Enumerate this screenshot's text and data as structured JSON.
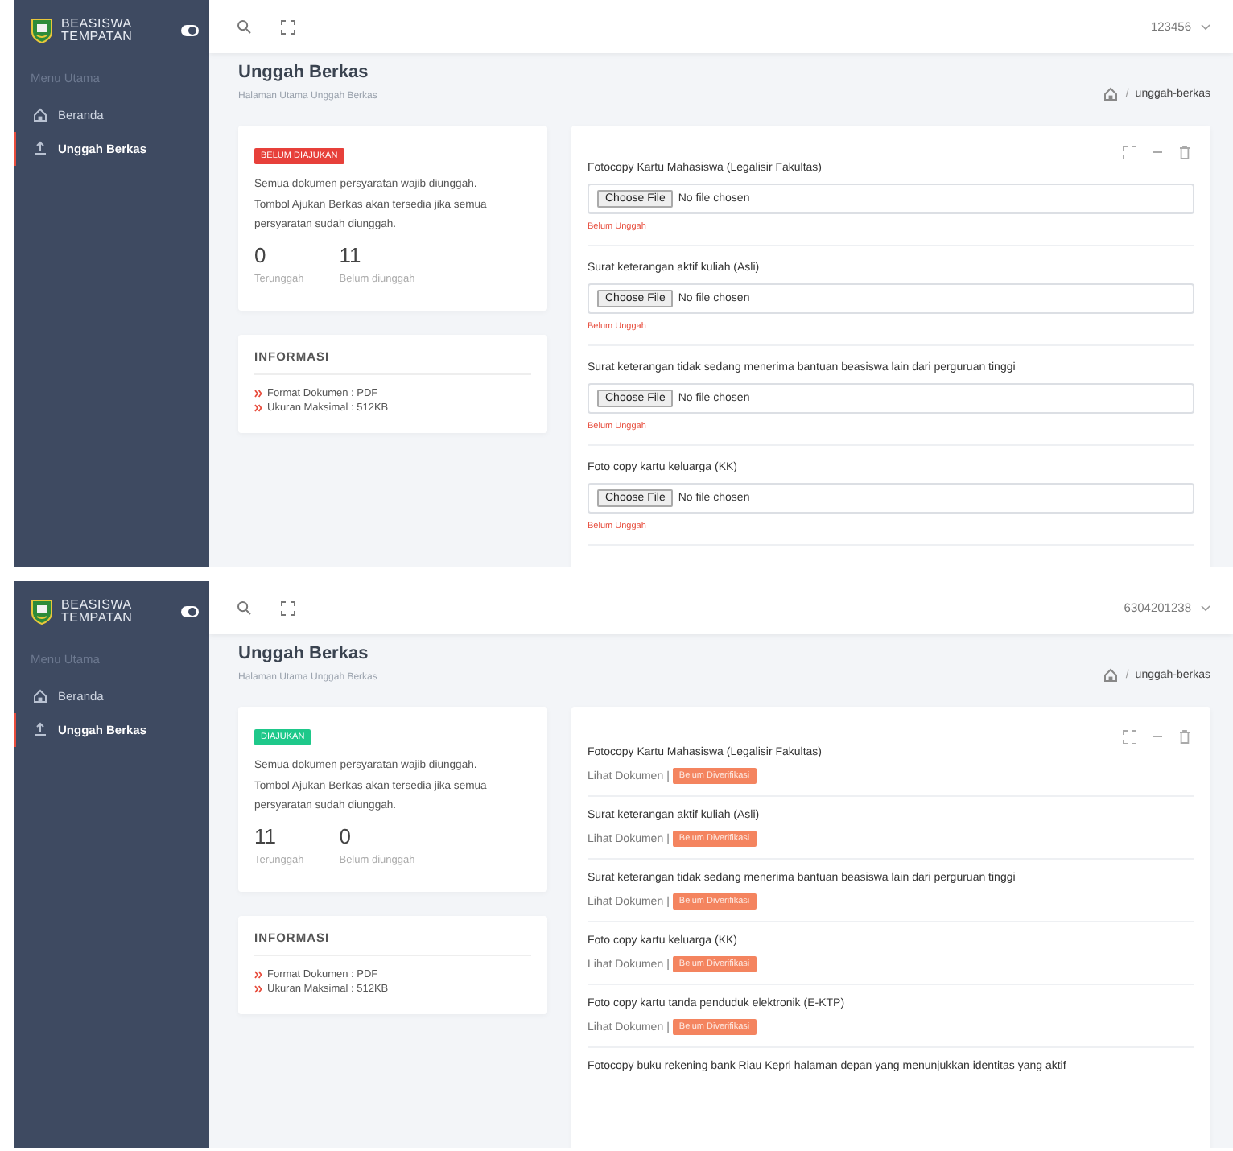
{
  "screens": [
    {
      "sidebar": {
        "brand": [
          "BEASISWA",
          "TEMPATAN"
        ],
        "section": "Menu Utama",
        "items": [
          {
            "label": "Beranda",
            "selected": false
          },
          {
            "label": "Unggah Berkas",
            "selected": true
          }
        ]
      },
      "topbar": {
        "user": "123456"
      },
      "header": {
        "title": "Unggah Berkas",
        "subtitle": "Halaman Utama Unggah Berkas",
        "breadcrumb_separator": "/",
        "breadcrumb": "unggah-berkas"
      },
      "status": {
        "label": "BELUM DIAJUKAN",
        "kind": "pending"
      },
      "description": "Semua dokumen persyaratan wajib diunggah. Tombol Ajukan Berkas akan tersedia jika semua persyaratan sudah diunggah.",
      "stats": [
        {
          "value": "0",
          "label": "Terunggah"
        },
        {
          "value": "11",
          "label": "Belum diunggah"
        }
      ],
      "info": {
        "title": "INFORMASI",
        "items": [
          "Format Dokumen : PDF",
          "Ukuran Maksimal : 512KB"
        ]
      },
      "documents": [
        {
          "kind": "upload",
          "title": "Fotocopy Kartu Mahasiswa (Legalisir Fakultas)",
          "button": "Choose File",
          "file": "No file chosen",
          "note": "Belum Unggah"
        },
        {
          "kind": "upload",
          "title": "Surat keterangan aktif kuliah (Asli)",
          "button": "Choose File",
          "file": "No file chosen",
          "note": "Belum Unggah"
        },
        {
          "kind": "upload",
          "title": "Surat keterangan tidak sedang menerima bantuan beasiswa lain dari perguruan tinggi",
          "button": "Choose File",
          "file": "No file chosen",
          "note": "Belum Unggah"
        },
        {
          "kind": "upload",
          "title": "Foto copy kartu keluarga (KK)",
          "button": "Choose File",
          "file": "No file chosen",
          "note": "Belum Unggah"
        }
      ]
    },
    {
      "sidebar": {
        "brand": [
          "BEASISWA",
          "TEMPATAN"
        ],
        "section": "Menu Utama",
        "items": [
          {
            "label": "Beranda",
            "selected": false
          },
          {
            "label": "Unggah Berkas",
            "selected": true
          }
        ]
      },
      "topbar": {
        "user": "6304201238"
      },
      "header": {
        "title": "Unggah Berkas",
        "subtitle": "Halaman Utama Unggah Berkas",
        "breadcrumb_separator": "/",
        "breadcrumb": "unggah-berkas"
      },
      "status": {
        "label": "DIAJUKAN",
        "kind": "submitted"
      },
      "description": "Semua dokumen persyaratan wajib diunggah. Tombol Ajukan Berkas akan tersedia jika semua persyaratan sudah diunggah.",
      "stats": [
        {
          "value": "11",
          "label": "Terunggah"
        },
        {
          "value": "0",
          "label": "Belum diunggah"
        }
      ],
      "info": {
        "title": "INFORMASI",
        "items": [
          "Format Dokumen : PDF",
          "Ukuran Maksimal : 512KB"
        ]
      },
      "documents": [
        {
          "kind": "uploaded",
          "title": "Fotocopy Kartu Mahasiswa (Legalisir Fakultas)",
          "link": "Lihat Dokumen",
          "separator": "|",
          "badge": "Belum Diverifikasi"
        },
        {
          "kind": "uploaded",
          "title": "Surat keterangan aktif kuliah (Asli)",
          "link": "Lihat Dokumen",
          "separator": "|",
          "badge": "Belum Diverifikasi"
        },
        {
          "kind": "uploaded",
          "title": "Surat keterangan tidak sedang menerima bantuan beasiswa lain dari perguruan tinggi",
          "link": "Lihat Dokumen",
          "separator": "|",
          "badge": "Belum Diverifikasi"
        },
        {
          "kind": "uploaded",
          "title": "Foto copy kartu keluarga (KK)",
          "link": "Lihat Dokumen",
          "separator": "|",
          "badge": "Belum Diverifikasi"
        },
        {
          "kind": "uploaded",
          "title": "Foto copy kartu tanda penduduk elektronik (E-KTP)",
          "link": "Lihat Dokumen",
          "separator": "|",
          "badge": "Belum Diverifikasi"
        },
        {
          "kind": "title-only",
          "title": "Fotocopy buku rekening bank Riau Kepri halaman depan yang menunjukkan identitas yang aktif"
        }
      ]
    }
  ]
}
